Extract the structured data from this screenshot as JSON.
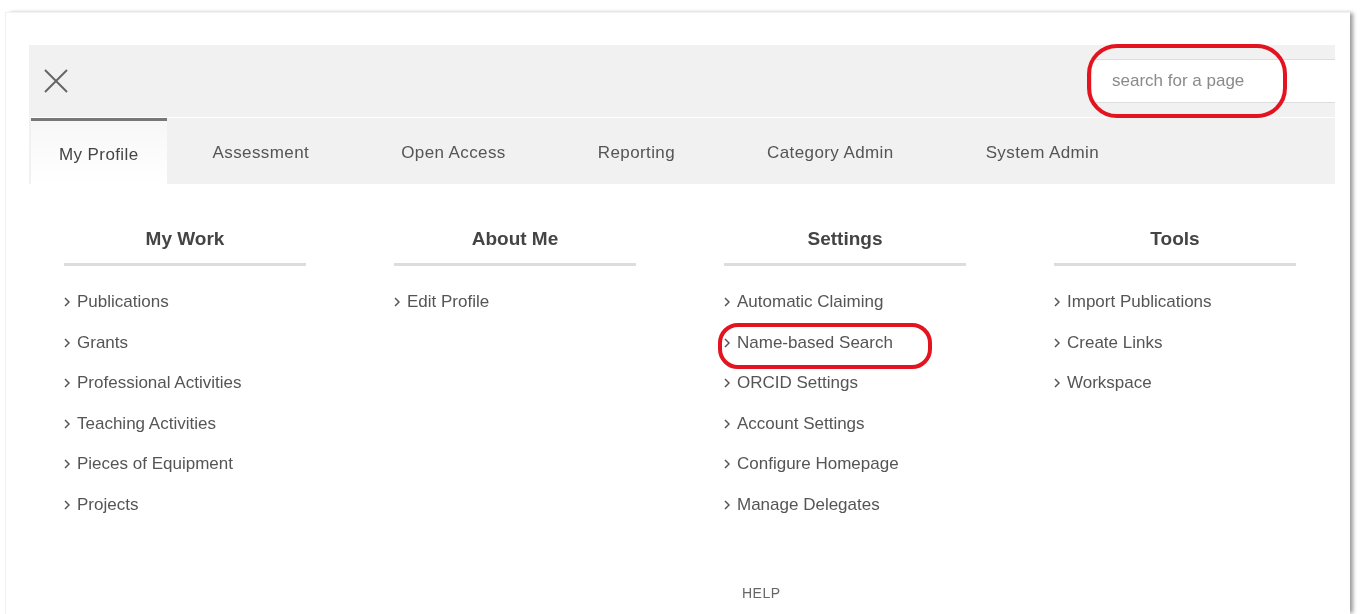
{
  "search": {
    "placeholder": "search for a page",
    "highlighted": true
  },
  "tabs": [
    {
      "label": "My Profile",
      "selected": true
    },
    {
      "label": "Assessment",
      "selected": false
    },
    {
      "label": "Open Access",
      "selected": false
    },
    {
      "label": "Reporting",
      "selected": false
    },
    {
      "label": "Category Admin",
      "selected": false
    },
    {
      "label": "System Admin",
      "selected": false
    }
  ],
  "columns": [
    {
      "heading": "My Work",
      "items": [
        {
          "label": "Publications",
          "highlighted": false
        },
        {
          "label": "Grants",
          "highlighted": false
        },
        {
          "label": "Professional Activities",
          "highlighted": false
        },
        {
          "label": "Teaching Activities",
          "highlighted": false
        },
        {
          "label": "Pieces of Equipment",
          "highlighted": false
        },
        {
          "label": "Projects",
          "highlighted": false
        }
      ]
    },
    {
      "heading": "About Me",
      "items": [
        {
          "label": "Edit Profile",
          "highlighted": false
        }
      ]
    },
    {
      "heading": "Settings",
      "items": [
        {
          "label": "Automatic Claiming",
          "highlighted": false
        },
        {
          "label": "Name-based Search",
          "highlighted": true
        },
        {
          "label": "ORCID Settings",
          "highlighted": false
        },
        {
          "label": "Account Settings",
          "highlighted": false
        },
        {
          "label": "Configure Homepage",
          "highlighted": false
        },
        {
          "label": "Manage Delegates",
          "highlighted": false
        }
      ]
    },
    {
      "heading": "Tools",
      "items": [
        {
          "label": "Import Publications",
          "highlighted": false
        },
        {
          "label": "Create Links",
          "highlighted": false
        },
        {
          "label": "Workspace",
          "highlighted": false
        }
      ]
    }
  ],
  "help": "HELP"
}
